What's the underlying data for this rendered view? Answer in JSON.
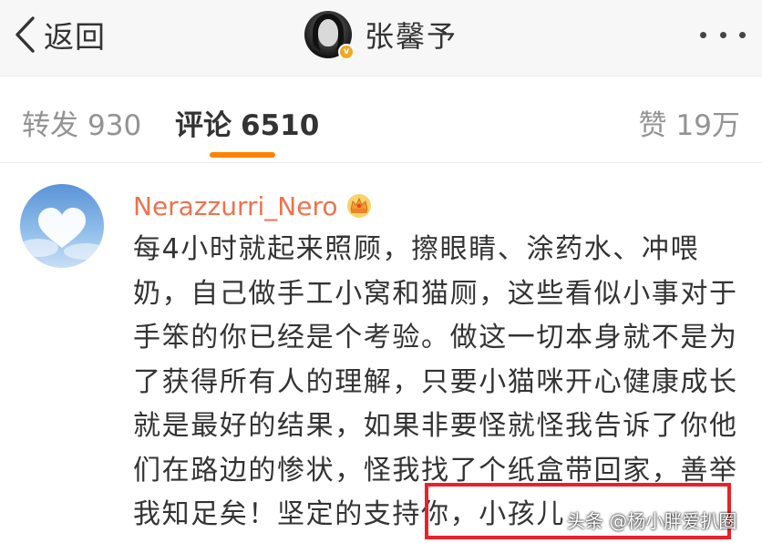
{
  "header": {
    "back_label": "返回",
    "profile_name": "张馨予",
    "verified_badge": "v",
    "back_icon": "chevron-left-icon",
    "more_icon": "more-dots-icon"
  },
  "tabs": {
    "repost": {
      "label": "转发",
      "count": "930"
    },
    "comment": {
      "label": "评论",
      "count": "6510",
      "active": true
    },
    "like": {
      "label": "赞",
      "count": "19万"
    }
  },
  "comment": {
    "username": "Nerazzurri_Nero",
    "badge_icon": "crown-icon",
    "text": "每4小时就起来照顾，擦眼睛、涂药水、冲喂奶，自己做手工小窝和猫厕，这些看似小事对于手笨的你已经是个考验。做这一切本身就不是为了获得所有人的理解，只要小猫咪开心健康成长就是最好的结果，如果非要怪就怪我告诉了你他们在路边的惨状，怪我找了个纸盒带回家，善举我知足矣！坚定的支持你，小孩儿"
  },
  "watermark": "头条 @杨小胖爱扒圈",
  "colors": {
    "accent": "#ff8200",
    "username": "#eb7350",
    "highlight": "#e8212b"
  }
}
